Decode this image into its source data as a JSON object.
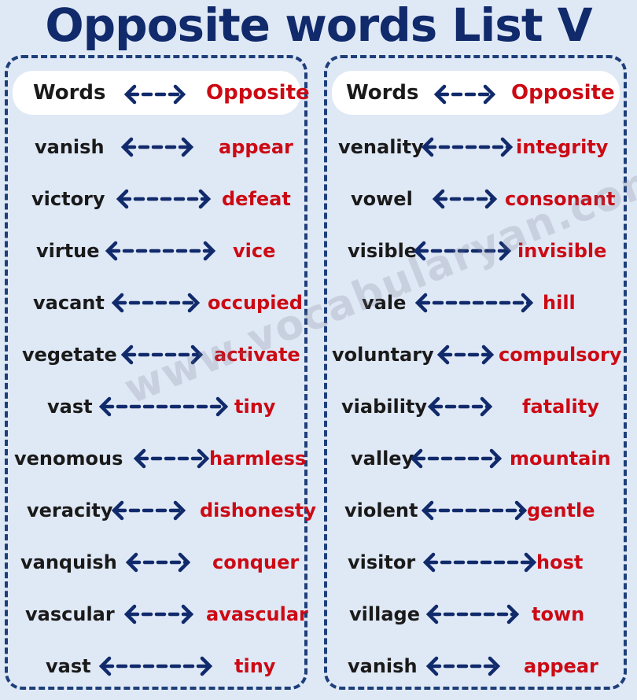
{
  "title": "Opposite words List V",
  "header": {
    "words": "Words",
    "opposite": "Opposite"
  },
  "watermark": "www.vocabularyan.com",
  "colors": {
    "title": "#102a6b",
    "arrow": "#102a6b",
    "opposite": "#cc0a14",
    "word": "#1a1a1a"
  },
  "left_pairs": [
    {
      "word": "vanish",
      "opposite": "appear"
    },
    {
      "word": "victory",
      "opposite": "defeat"
    },
    {
      "word": "virtue",
      "opposite": "vice"
    },
    {
      "word": "vacant",
      "opposite": "occupied"
    },
    {
      "word": "vegetate",
      "opposite": "activate"
    },
    {
      "word": "vast",
      "opposite": "tiny"
    },
    {
      "word": "venomous",
      "opposite": "harmless"
    },
    {
      "word": "veracity",
      "opposite": "dishonesty"
    },
    {
      "word": "vanquish",
      "opposite": "conquer"
    },
    {
      "word": "vascular",
      "opposite": "avascular"
    },
    {
      "word": "vast",
      "opposite": "tiny"
    }
  ],
  "right_pairs": [
    {
      "word": "venality",
      "opposite": "integrity"
    },
    {
      "word": "vowel",
      "opposite": "consonant"
    },
    {
      "word": "visible",
      "opposite": "invisible"
    },
    {
      "word": "vale",
      "opposite": "hill"
    },
    {
      "word": "voluntary",
      "opposite": "compulsory"
    },
    {
      "word": "viability",
      "opposite": "fatality"
    },
    {
      "word": "valley",
      "opposite": "mountain"
    },
    {
      "word": "violent",
      "opposite": "gentle"
    },
    {
      "word": "visitor",
      "opposite": "host"
    },
    {
      "word": "village",
      "opposite": "town"
    },
    {
      "word": "vanish",
      "opposite": "appear"
    }
  ]
}
